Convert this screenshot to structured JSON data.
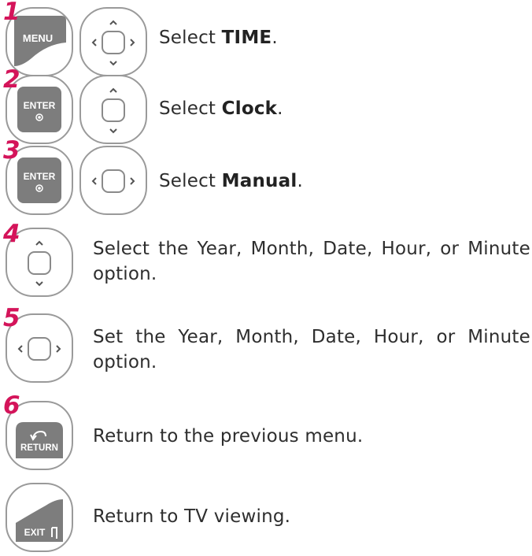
{
  "steps": [
    {
      "number": "1",
      "prefix": "Select ",
      "bold": "TIME",
      "suffix": ".",
      "buttons": [
        "MENU",
        "nav-4way"
      ]
    },
    {
      "number": "2",
      "prefix": "Select ",
      "bold": "Clock",
      "suffix": ".",
      "buttons": [
        "ENTER",
        "nav-updown"
      ]
    },
    {
      "number": "3",
      "prefix": "Select ",
      "bold": "Manual",
      "suffix": ".",
      "buttons": [
        "ENTER",
        "nav-leftright"
      ]
    },
    {
      "number": "4",
      "text": "Select the Year, Month, Date, Hour, or Minute option.",
      "buttons": [
        "nav-updown"
      ]
    },
    {
      "number": "5",
      "text": "Set the Year, Month, Date, Hour, or Minute option.",
      "buttons": [
        "nav-leftright"
      ]
    },
    {
      "number": "6",
      "text": "Return to the previous menu.",
      "buttons": [
        "RETURN"
      ]
    },
    {
      "number": "",
      "text": "Return to TV viewing.",
      "buttons": [
        "EXIT"
      ]
    }
  ],
  "button_labels": {
    "menu": "MENU",
    "enter": "ENTER",
    "return": "RETURN",
    "exit": "EXIT"
  },
  "colors": {
    "step_number": "#d4145a",
    "button_fill": "#7d7d7d",
    "key_outline": "#9a9a9a"
  }
}
